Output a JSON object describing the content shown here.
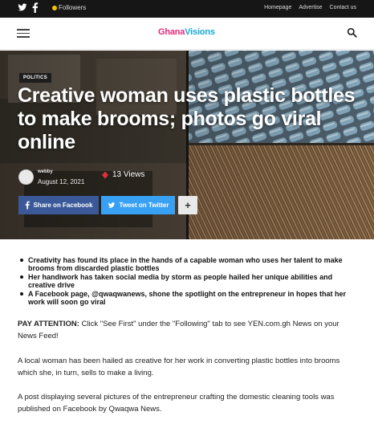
{
  "topbar": {
    "followers_label": "Followers",
    "links": [
      "Homepage",
      "Advertise",
      "Contact us"
    ],
    "icons": [
      "twitter-icon",
      "facebook-icon"
    ]
  },
  "header": {
    "logo_part1": "Ghana",
    "logo_part2": "Visions",
    "icons": [
      "hamburger-menu-icon",
      "search-icon"
    ]
  },
  "hero": {
    "category": "POLITICS",
    "title": "Creative woman uses plastic bottles to make brooms; photos go viral online",
    "author": "webby",
    "date": "August 12, 2021",
    "views": "13 Views",
    "share_facebook": "Share on Facebook",
    "share_twitter": "Tweet on Twitter",
    "more_share": "+"
  },
  "article": {
    "bullets": [
      "Creativity has found its place in the hands of a capable woman who uses her talent to make brooms from discarded plastic bottles",
      "Her handiwork has taken social media by storm as people hailed her unique abilities and creative drive",
      "A Facebook page, @qwaqwanews, shone the spotlight on the entrepreneur in hopes that her work will soon go viral"
    ],
    "pay_attention_label": "PAY ATTENTION:",
    "pay_attention_text": " Click \"See First\" under the \"Following\" tab to see YEN.com.gh News on your News Feed!",
    "para2": "A local woman has been hailed as creative for her work in converting plastic bottles into brooms which she, in turn, sells to make a living.",
    "para3": "A post displaying several pictures of the entrepreneur crafting the domestic cleaning tools was published on Facebook by Qwaqwa News."
  },
  "colors": {
    "topbar_bg": "#161616",
    "facebook": "#3b5998",
    "twitter": "#38a1f3",
    "logo_pink": "#e02b7a",
    "logo_blue": "#15a7d8",
    "views_icon": "#e0303a"
  }
}
